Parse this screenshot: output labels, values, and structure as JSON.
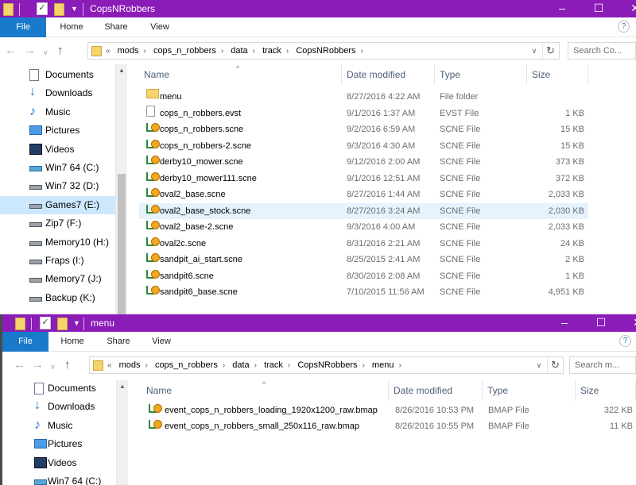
{
  "window1": {
    "title": "CopsNRobbers",
    "ribbon_tabs": [
      "File",
      "Home",
      "Share",
      "View"
    ],
    "path_overflow": "«",
    "breadcrumbs": [
      "mods",
      "cops_n_robbers",
      "data",
      "track",
      "CopsNRobbers"
    ],
    "search_placeholder": "Search Co...",
    "nav": [
      "Documents",
      "Downloads",
      "Music",
      "Pictures",
      "Videos",
      "Win7 64 (C:)",
      "Win7 32 (D:)",
      "Games7 (E:)",
      "Zip7 (F:)",
      "Memory10 (H:)",
      "Fraps (I:)",
      "Memory7 (J:)",
      "Backup (K:)"
    ],
    "nav_icons": [
      "document-icon",
      "download-icon",
      "music-icon",
      "pictures-icon",
      "videos-icon",
      "network-drive-icon",
      "drive-icon",
      "drive-icon",
      "drive-icon",
      "drive-icon",
      "drive-icon",
      "drive-icon",
      "drive-icon"
    ],
    "nav_selected": "Games7 (E:)",
    "columns": [
      "Name",
      "Date modified",
      "Type",
      "Size"
    ],
    "files": [
      {
        "name": "menu",
        "date": "8/27/2016 4:22 AM",
        "type": "File folder",
        "size": "",
        "icon": "folder-icon"
      },
      {
        "name": "cops_n_robbers.evst",
        "date": "9/1/2016 1:37 AM",
        "type": "EVST File",
        "size": "1 KB",
        "icon": "file-icon"
      },
      {
        "name": "cops_n_robbers.scne",
        "date": "9/2/2016 6:59 AM",
        "type": "SCNE File",
        "size": "15 KB",
        "icon": "scne-file-icon"
      },
      {
        "name": "cops_n_robbers-2.scne",
        "date": "9/3/2016 4:30 AM",
        "type": "SCNE File",
        "size": "15 KB",
        "icon": "scne-file-icon"
      },
      {
        "name": "derby10_mower.scne",
        "date": "9/12/2016 2:00 AM",
        "type": "SCNE File",
        "size": "373 KB",
        "icon": "scne-file-icon"
      },
      {
        "name": "derby10_mower111.scne",
        "date": "9/1/2016 12:51 AM",
        "type": "SCNE File",
        "size": "372 KB",
        "icon": "scne-file-icon"
      },
      {
        "name": "oval2_base.scne",
        "date": "8/27/2016 1:44 AM",
        "type": "SCNE File",
        "size": "2,033 KB",
        "icon": "scne-file-icon"
      },
      {
        "name": "oval2_base_stock.scne",
        "date": "8/27/2016 3:24 AM",
        "type": "SCNE File",
        "size": "2,030 KB",
        "icon": "scne-file-icon"
      },
      {
        "name": "oval2_base-2.scne",
        "date": "9/3/2016 4:00 AM",
        "type": "SCNE File",
        "size": "2,033 KB",
        "icon": "scne-file-icon"
      },
      {
        "name": "oval2c.scne",
        "date": "8/31/2016 2:21 AM",
        "type": "SCNE File",
        "size": "24 KB",
        "icon": "scne-file-icon"
      },
      {
        "name": "sandpit_ai_start.scne",
        "date": "8/25/2015 2:41 AM",
        "type": "SCNE File",
        "size": "2 KB",
        "icon": "scne-file-icon"
      },
      {
        "name": "sandpit6.scne",
        "date": "8/30/2016 2:08 AM",
        "type": "SCNE File",
        "size": "1 KB",
        "icon": "scne-file-icon"
      },
      {
        "name": "sandpit6_base.scne",
        "date": "7/10/2015 11:56 AM",
        "type": "SCNE File",
        "size": "4,951 KB",
        "icon": "scne-file-icon"
      }
    ],
    "hovered_file": "oval2_base_stock.scne"
  },
  "window2": {
    "title": "menu",
    "ribbon_tabs": [
      "File",
      "Home",
      "Share",
      "View"
    ],
    "path_overflow": "«",
    "breadcrumbs": [
      "mods",
      "cops_n_robbers",
      "data",
      "track",
      "CopsNRobbers",
      "menu"
    ],
    "search_placeholder": "Search m...",
    "nav": [
      "Documents",
      "Downloads",
      "Music",
      "Pictures",
      "Videos",
      "Win7 64 (C:)"
    ],
    "nav_icons": [
      "document-icon",
      "download-icon",
      "music-icon",
      "pictures-icon",
      "videos-icon",
      "network-drive-icon"
    ],
    "columns": [
      "Name",
      "Date modified",
      "Type",
      "Size"
    ],
    "files": [
      {
        "name": "event_cops_n_robbers_loading_1920x1200_raw.bmap",
        "date": "8/26/2016 10:53 PM",
        "type": "BMAP File",
        "size": "322 KB",
        "icon": "bmap-file-icon"
      },
      {
        "name": "event_cops_n_robbers_small_250x116_raw.bmap",
        "date": "8/26/2016 10:55 PM",
        "type": "BMAP File",
        "size": "11 KB",
        "icon": "bmap-file-icon"
      }
    ]
  },
  "window_controls": {
    "minimize": "–",
    "maximize": "☐",
    "close": "✕"
  },
  "colors": {
    "titlebar": "#8b1cb8",
    "file_tab": "#1979ca",
    "selected_nav": "#cce8ff",
    "hover_row": "#e5f3ff"
  }
}
